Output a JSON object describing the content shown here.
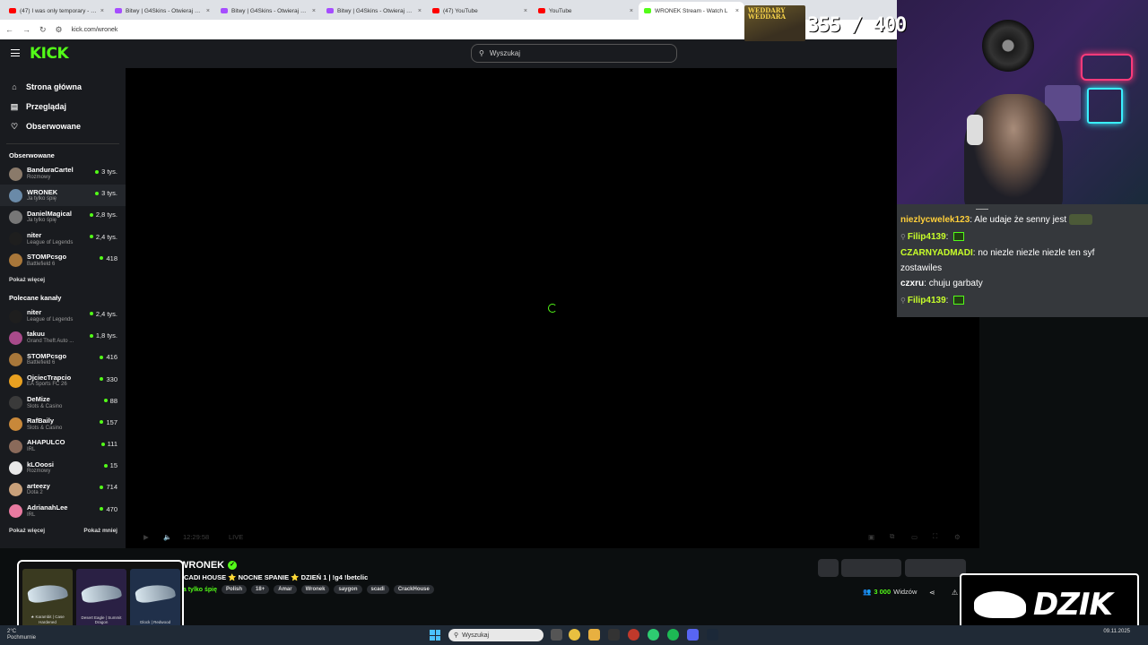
{
  "browser": {
    "tabs": [
      {
        "title": "(47) I was only temporary - You",
        "fav": "#ff0000"
      },
      {
        "title": "Bitwy | G4Skins - Otwieraj skrz",
        "fav": "#a64dff"
      },
      {
        "title": "Bitwy | G4Skins - Otwieraj skrz",
        "fav": "#a64dff"
      },
      {
        "title": "Bitwy | G4Skins - Otwieraj skrz",
        "fav": "#a64dff"
      },
      {
        "title": "(47) YouTube",
        "fav": "#ff0000"
      },
      {
        "title": "YouTube",
        "fav": "#ff0000"
      },
      {
        "title": "WRONEK Stream - Watch L",
        "fav": "#53fc18"
      }
    ],
    "url": "kick.com/wronek"
  },
  "header": {
    "logo": "KICK",
    "search_placeholder": "Wyszukaj"
  },
  "sidebar": {
    "nav": [
      {
        "label": "Strona główna",
        "icon": "home-icon"
      },
      {
        "label": "Przeglądaj",
        "icon": "browse-icon"
      },
      {
        "label": "Obserwowane",
        "icon": "heart-icon"
      }
    ],
    "followed_title": "Obserwowane",
    "followed": [
      {
        "name": "BanduraCartel",
        "cat": "Rozmowy",
        "viewers": "3 tys.",
        "color": "#8a7a6a"
      },
      {
        "name": "WRONEK",
        "cat": "Ja tylko śpię",
        "viewers": "3 tys.",
        "color": "#6a8aa8"
      },
      {
        "name": "DanielMagical",
        "cat": "Ja tylko śpię",
        "viewers": "2,8 tys.",
        "color": "#777777"
      },
      {
        "name": "niter",
        "cat": "League of Legends",
        "viewers": "2,4 tys.",
        "color": "#1e1e1e"
      },
      {
        "name": "STOMPcsgo",
        "cat": "Battlefield 6",
        "viewers": "418",
        "color": "#a8773a"
      }
    ],
    "show_more": "Pokaż więcej",
    "recommended_title": "Polecane kanały",
    "recommended": [
      {
        "name": "niter",
        "cat": "League of Legends",
        "viewers": "2,4 tys.",
        "color": "#1e1e1e"
      },
      {
        "name": "takuu",
        "cat": "Grand Theft Auto ...",
        "viewers": "1,8 tys.",
        "color": "#a84a8a"
      },
      {
        "name": "STOMPcsgo",
        "cat": "Battlefield 6",
        "viewers": "416",
        "color": "#a8773a"
      },
      {
        "name": "OjciecTrapcio",
        "cat": "EA Sports FC 26",
        "viewers": "330",
        "color": "#e8a020"
      },
      {
        "name": "DeMize",
        "cat": "Slots & Casino",
        "viewers": "88",
        "color": "#3a3a3a"
      },
      {
        "name": "RafBaily",
        "cat": "Slots & Casino",
        "viewers": "157",
        "color": "#c8883a"
      },
      {
        "name": "AHAPULCO",
        "cat": "IRL",
        "viewers": "111",
        "color": "#8a6a5a"
      },
      {
        "name": "kLOoosi",
        "cat": "Rozmowy",
        "viewers": "15",
        "color": "#e8e8e8"
      },
      {
        "name": "arteezy",
        "cat": "Dota 2",
        "viewers": "714",
        "color": "#c8a07a"
      },
      {
        "name": "AdrianahLee",
        "cat": "IRL",
        "viewers": "470",
        "color": "#e87aa0"
      }
    ],
    "show_more_2": "Pokaż więcej",
    "show_less": "Pokaż mniej"
  },
  "player": {
    "time": "12:29:58",
    "live": "LIVE"
  },
  "channel": {
    "name": "WRONEK",
    "title": "SCADI HOUSE ⭐ NOCNE SPANIE ⭐ DZIEŃ 1 | !g4 !betclic",
    "category": "Ja tylko śpię",
    "tags": [
      "Polish",
      "18+",
      "Amar",
      "Wronek",
      "saygon",
      "scadi",
      "CrackHouse"
    ],
    "viewers_num": "3 000",
    "viewers_label": "Widzów"
  },
  "goal": {
    "label": "WEDDARY WEDDARA",
    "value": "355 / 400"
  },
  "chat": [
    {
      "user": "niezlycwelek123",
      "msg": "Ale udaje że senny jest",
      "emote": true,
      "badge": false
    },
    {
      "user": "Filip4139",
      "msg": "",
      "emote": false,
      "badge": true,
      "mini": true
    },
    {
      "user": "CZARNYADMADI",
      "msg": "no niezle niezle niezle ten syf zostawiles",
      "emote": false,
      "badge": false,
      "wrap": true
    },
    {
      "user": "czxru",
      "msg": "chuju garbaty",
      "emote": false,
      "badge": false,
      "white": true
    },
    {
      "user": "Filip4139",
      "msg": "",
      "emote": false,
      "badge": true,
      "mini": true
    }
  ],
  "cases": [
    {
      "label": "★ Karambit | Case Hardened",
      "bg": "#3a3a20"
    },
    {
      "label": "Desert Eagle | Summit Dragon",
      "bg": "#2a2044"
    },
    {
      "label": "Glock | Redwood",
      "bg": "#20304a"
    }
  ],
  "overlay_logo": "DZIK",
  "taskbar": {
    "weather_temp": "2°C",
    "weather_desc": "Pochmurnie",
    "search": "Wyszukaj",
    "time": "",
    "date": "09.11.2025"
  }
}
